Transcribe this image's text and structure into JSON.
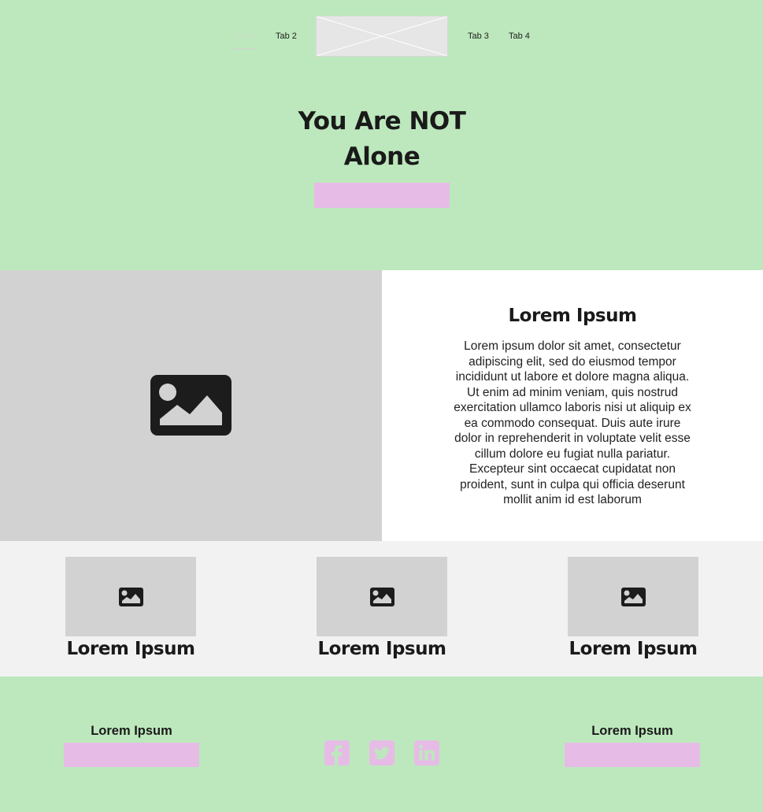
{
  "nav": {
    "tabs": [
      {
        "label": "Tab 1",
        "active": true
      },
      {
        "label": "Tab 2",
        "active": false
      },
      {
        "label": "Tab 3",
        "active": false
      },
      {
        "label": "Tab 4",
        "active": false
      }
    ],
    "logo_placeholder": "image-placeholder"
  },
  "hero": {
    "title_line1": "You Are NOT",
    "title_line2": "Alone",
    "cta_label": ""
  },
  "feature": {
    "heading": "Lorem Ipsum",
    "body": "Lorem ipsum dolor sit amet, consectetur adipiscing elit, sed do eiusmod tempor incididunt ut labore et dolore magna aliqua. Ut enim ad minim veniam, quis nostrud exercitation ullamco laboris nisi ut aliquip ex ea commodo consequat. Duis aute irure dolor in reprehenderit in voluptate velit esse cillum dolore eu fugiat nulla pariatur. Excepteur sint occaecat cupidatat non proident, sunt in culpa qui officia deserunt mollit anim id est laborum",
    "image_icon": "image-icon"
  },
  "cards": [
    {
      "title": "Lorem Ipsum",
      "icon": "image-icon"
    },
    {
      "title": "Lorem Ipsum",
      "icon": "image-icon"
    },
    {
      "title": "Lorem Ipsum",
      "icon": "image-icon"
    }
  ],
  "footer": {
    "left": {
      "label": "Lorem Ipsum",
      "button_label": ""
    },
    "right": {
      "label": "Lorem Ipsum",
      "button_label": ""
    },
    "social": [
      "facebook-icon",
      "twitter-icon",
      "linkedin-icon"
    ]
  },
  "colors": {
    "hero_bg": "#bde8bd",
    "accent_pink": "#e6bce6",
    "placeholder_gray": "#d2d2d2",
    "cards_bg": "#f2f2f2",
    "text_dark": "#1a1a1a"
  }
}
